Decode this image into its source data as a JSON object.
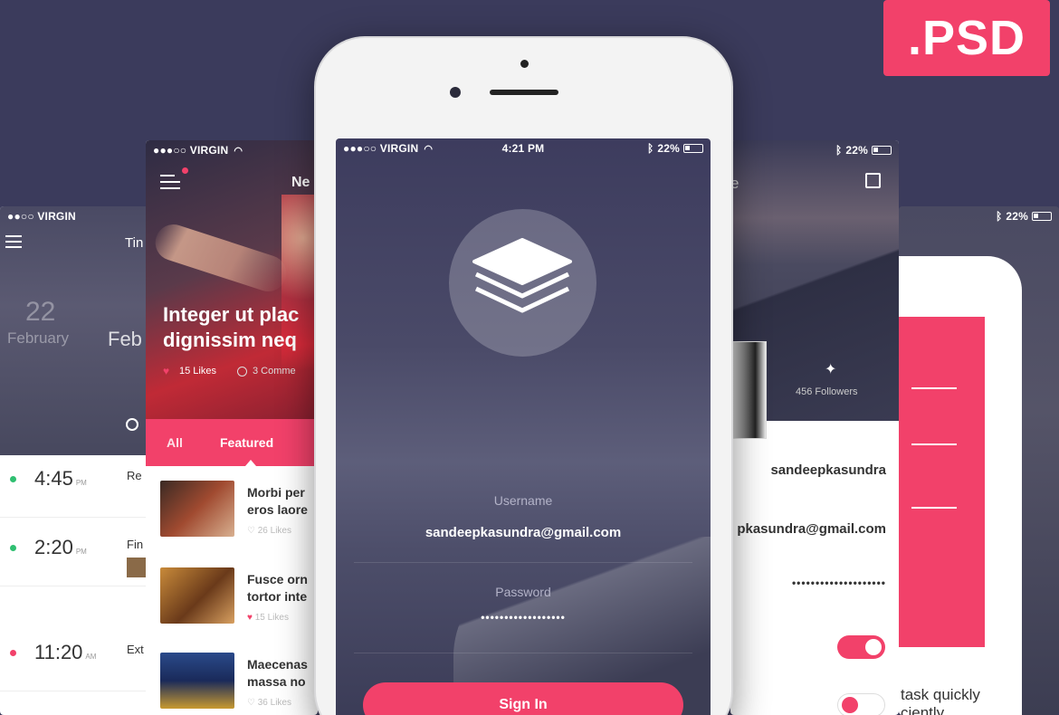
{
  "badge": {
    "label": ".PSD"
  },
  "colors": {
    "accent": "#f2416a",
    "background": "#3b3b5c"
  },
  "screen_left": {
    "status": {
      "carrier": "●●○○ VIRGIN"
    },
    "header_title": "Tin",
    "date_day": "22",
    "date_month": "February",
    "date_month_alt": "Feb",
    "times": [
      {
        "time": "4:45",
        "ampm": "PM",
        "text": "Re",
        "dot": "#2fbf71"
      },
      {
        "time": "2:20",
        "ampm": "PM",
        "text": "Fin",
        "dot": "#2fbf71"
      },
      {
        "time": "11:20",
        "ampm": "AM",
        "text": "Ext",
        "dot": "#f2416a"
      }
    ]
  },
  "screen_news": {
    "status": {
      "carrier": "●●●○○ VIRGIN"
    },
    "title": "Ne",
    "hero_text_1": "Integer ut plac",
    "hero_text_2": "dignissim neq",
    "likes": "15 Likes",
    "comments": "3 Comme",
    "tabs": [
      "All",
      "Featured"
    ],
    "items": [
      {
        "title_1": "Morbi per",
        "title_2": "eros laore",
        "likes": "26 Likes",
        "liked": false
      },
      {
        "title_1": "Fusce orn",
        "title_2": "tortor inte",
        "likes": "15 Likes",
        "liked": true
      },
      {
        "title_1": "Maecenas",
        "title_2": "massa no",
        "likes": "36 Likes",
        "liked": false
      }
    ]
  },
  "screen_main": {
    "status": {
      "carrier": "●●●○○ VIRGIN",
      "time": "4:21 PM",
      "battery": "22%"
    },
    "username_label": "Username",
    "username_value": "sandeepkasundra@gmail.com",
    "password_label": "Password",
    "password_value": "••••••••••••••••••",
    "sign_in": "Sign In"
  },
  "screen_profile": {
    "status": {
      "battery": "22%"
    },
    "title_partial": "e",
    "followers": "456 Followers",
    "username": "sandeepkasundra",
    "email": "pkasundra@gmail.com",
    "password": "••••••••••••••••••••"
  },
  "screen_far_right": {
    "status": {
      "battery": "22%"
    },
    "text_1": "task quickly",
    "text_2": "ciently"
  }
}
